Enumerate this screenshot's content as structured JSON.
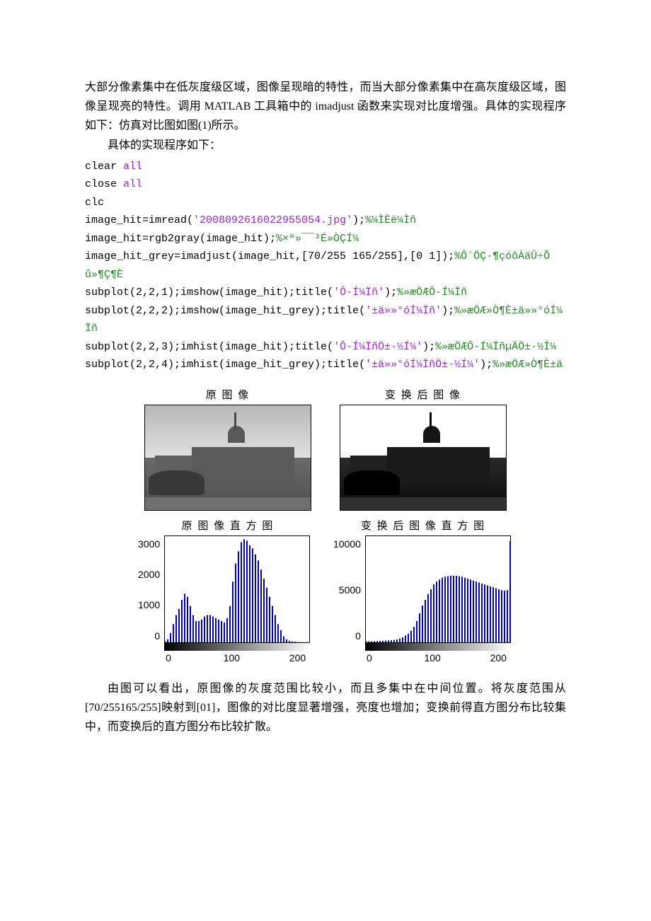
{
  "paragraphs": {
    "p1": "大部分像素集中在低灰度级区域，图像呈现暗的特性，而当大部分像素集中在高灰度级区域，图像呈现亮的特性。调用 MATLAB 工具箱中的 imadjust 函数来实现对比度增强。具体的实现程序如下：仿真对比图如图(1)所示。",
    "p2": "具体的实现程序如下：",
    "p3": "由图可以看出，原图像的灰度范围比较小，而且多集中在中间位置。将灰度范围从[70/255165/255]映射到[01]，图像的对比度显著增强，亮度也增加；变换前得直方图分布比较集中，而变换后的直方图分布比较扩散。"
  },
  "code": {
    "l1_a": "clear ",
    "l1_b": "all",
    "l2_a": "close ",
    "l2_b": "all",
    "l3": "clc",
    "l4_a": "image_hit=imread(",
    "l4_s": "'2008092616022955054.jpg'",
    "l4_b": ");",
    "l4_c": "%¼ÌÈë¼Ìñ",
    "l5_a": "image_hit=rgb2gray(image_hit);",
    "l5_c": "%×ª»¯¯³É»ÒÇÍ¼",
    "l6_a": "image_hit_grey=imadjust(image_hit,[70/255 165/255],[0 1]);",
    "l6_c": "%Ô´ÖÇ·¶çóõÀäÛ÷Õû»¶Ç¶È",
    "l7_a": "subplot(2,2,1);imshow(image_hit);title(",
    "l7_s": "'Ô-Í¼Ïñ'",
    "l7_b": ");",
    "l7_c": "%»æÖÆÔ-Í¼Ïñ",
    "l8_a": "subplot(2,2,2);imshow(image_hit_grey);title(",
    "l8_s": "'±ä»»°óÍ¼Ïñ'",
    "l8_b": ");",
    "l8_c": "%»æÖÆ»Ò¶È±ä»»°óÍ¼Ïñ",
    "l9_a": "subplot(2,2,3);imhist(image_hit);title(",
    "l9_s": "'Ô-Í¼ÏñÖ±·½Í¼'",
    "l9_b": ");",
    "l9_c": "%»æÖÆÔ-Í¼ÏñµÄÖ±·½Í¼",
    "l10_a": "subplot(2,2,4);imhist(image_hit_grey);title(",
    "l10_s": "'±ä»»°óÍ¼ÏñÖ±·½Í¼'",
    "l10_b": ");",
    "l10_c": "%»æÖÆ»Ò¶È±ä"
  },
  "figure_titles": {
    "t1": "原 图 像",
    "t2": "变 换 后 图 像",
    "t3": "原 图 像 直 方 图",
    "t4": "变 换 后 图 像 直 方 图"
  },
  "chart_data": [
    {
      "type": "bar",
      "title": "原图像直方图",
      "xlabel": "",
      "ylabel": "",
      "xlim": [
        0,
        255
      ],
      "ylim": [
        0,
        3500
      ],
      "x_ticks": [
        0,
        100,
        200
      ],
      "y_ticks": [
        0,
        1000,
        2000,
        3000
      ],
      "x": [
        0,
        5,
        10,
        15,
        20,
        25,
        30,
        35,
        40,
        45,
        50,
        55,
        60,
        65,
        70,
        75,
        80,
        85,
        90,
        95,
        100,
        105,
        110,
        115,
        120,
        125,
        130,
        135,
        140,
        145,
        150,
        155,
        160,
        165,
        170,
        175,
        180,
        185,
        190,
        195,
        200,
        205,
        210,
        215,
        220,
        225,
        230,
        235,
        240,
        245,
        250,
        255
      ],
      "values": [
        50,
        100,
        300,
        600,
        900,
        1100,
        1400,
        1600,
        1500,
        1200,
        900,
        700,
        700,
        750,
        850,
        900,
        900,
        850,
        800,
        750,
        700,
        650,
        800,
        1200,
        2000,
        2600,
        3000,
        3300,
        3400,
        3350,
        3200,
        3100,
        2900,
        2700,
        2400,
        2100,
        1800,
        1500,
        1200,
        900,
        600,
        400,
        200,
        100,
        50,
        30,
        20,
        10,
        5,
        5,
        5,
        0
      ]
    },
    {
      "type": "bar",
      "title": "变换后图像直方图",
      "xlabel": "",
      "ylabel": "",
      "xlim": [
        0,
        255
      ],
      "ylim": [
        0,
        11000
      ],
      "x_ticks": [
        0,
        100,
        200
      ],
      "y_ticks": [
        0,
        5000,
        10000
      ],
      "x": [
        0,
        5,
        10,
        15,
        20,
        25,
        30,
        35,
        40,
        45,
        50,
        55,
        60,
        65,
        70,
        75,
        80,
        85,
        90,
        95,
        100,
        105,
        110,
        115,
        120,
        125,
        130,
        135,
        140,
        145,
        150,
        155,
        160,
        165,
        170,
        175,
        180,
        185,
        190,
        195,
        200,
        205,
        210,
        215,
        220,
        225,
        230,
        235,
        240,
        245,
        250,
        255
      ],
      "values": [
        100,
        100,
        100,
        120,
        120,
        140,
        160,
        180,
        200,
        230,
        250,
        300,
        400,
        500,
        700,
        900,
        1200,
        1600,
        2200,
        3000,
        3800,
        4400,
        5000,
        5500,
        6000,
        6300,
        6500,
        6700,
        6800,
        6850,
        6900,
        6900,
        6900,
        6850,
        6800,
        6700,
        6600,
        6500,
        6400,
        6300,
        6200,
        6100,
        6000,
        5900,
        5800,
        5700,
        5600,
        5500,
        5400,
        5350,
        5400,
        10500
      ]
    }
  ]
}
